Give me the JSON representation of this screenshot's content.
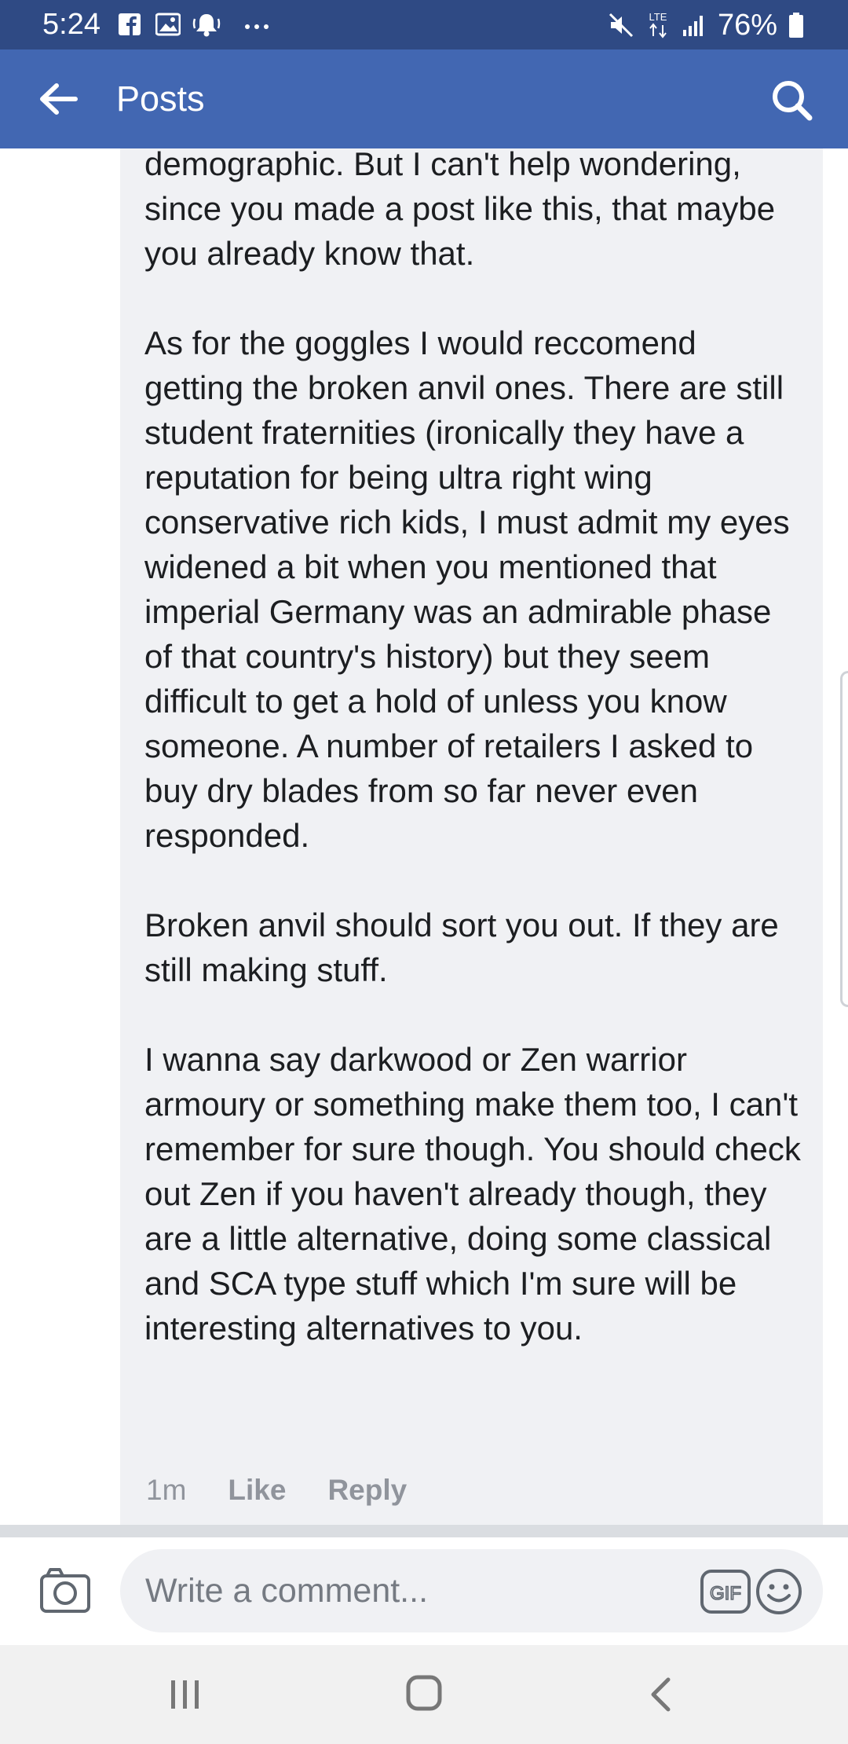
{
  "status_bar": {
    "time": "5:24",
    "network": "LTE",
    "battery": "76%"
  },
  "app_bar": {
    "title": "Posts"
  },
  "comment": {
    "paragraphs": [
      "demographic. But I can't help wondering, since you made a post like this, that maybe you already know that.",
      "As for the goggles I would reccomend getting the broken anvil ones. There are still student fraternities (ironically they have a reputation for being ultra right wing conservative rich kids, I must admit my eyes widened a bit when you mentioned that imperial Germany was an admirable phase of that country's history) but they seem difficult to get a hold of unless you know someone. A number of retailers I asked to buy dry blades from so far never even responded.",
      "Broken anvil should sort you out. If they are still making stuff.",
      "I wanna say darkwood or Zen warrior armoury or something make them too, I can't remember for sure though. You should check out Zen if you haven't already though, they are a little alternative, doing some classical and SCA type stuff which I'm sure will be interesting alternatives to you."
    ],
    "time": "1m",
    "like_label": "Like",
    "reply_label": "Reply"
  },
  "composer": {
    "placeholder": "Write a comment...",
    "gif_label": "GIF"
  },
  "icons": {
    "back": "arrow-left-icon",
    "search": "search-icon",
    "camera": "camera-icon",
    "emoji": "smiley-icon",
    "recents": "recents-icon",
    "home": "home-icon",
    "nav_back": "chevron-left-icon"
  },
  "colors": {
    "app_bar": "#4267b2",
    "status_bar": "#2f4a84",
    "bubble": "#f0f1f4",
    "meta_text": "#90949c"
  }
}
